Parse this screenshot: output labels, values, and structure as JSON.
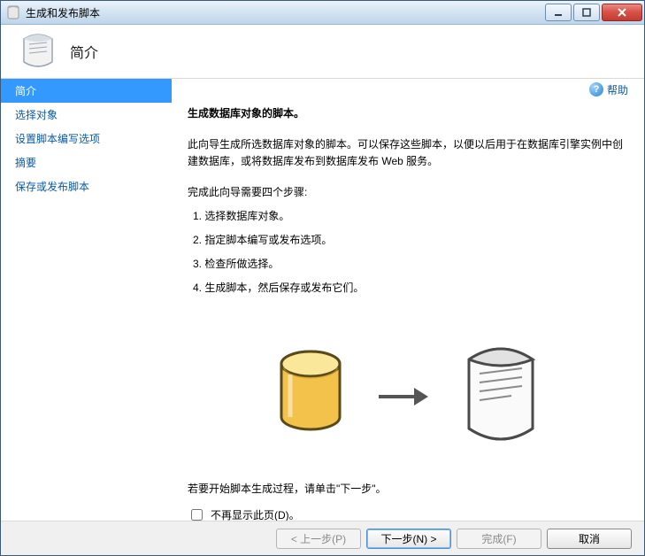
{
  "window": {
    "title": "生成和发布脚本"
  },
  "header": {
    "page_title": "简介"
  },
  "sidebar": {
    "items": [
      {
        "label": "简介"
      },
      {
        "label": "选择对象"
      },
      {
        "label": "设置脚本编写选项"
      },
      {
        "label": "摘要"
      },
      {
        "label": "保存或发布脚本"
      }
    ]
  },
  "help": {
    "label": "帮助"
  },
  "main": {
    "heading": "生成数据库对象的脚本。",
    "description": "此向导生成所选数据库对象的脚本。可以保存这些脚本，以便以后用于在数据库引擎实例中创建数据库，或将数据库发布到数据库发布 Web 服务。",
    "steps_intro": "完成此向导需要四个步骤:",
    "steps": [
      "1.  选择数据库对象。",
      "2.  指定脚本编写或发布选项。",
      "3.  检查所做选择。",
      "4.  生成脚本，然后保存或发布它们。"
    ],
    "bottom_line": "若要开始脚本生成过程，请单击\"下一步\"。",
    "checkbox_label": "不再显示此页(D)。"
  },
  "footer": {
    "back": "< 上一步(P)",
    "next": "下一步(N) >",
    "finish": "完成(F)",
    "cancel": "取消"
  }
}
